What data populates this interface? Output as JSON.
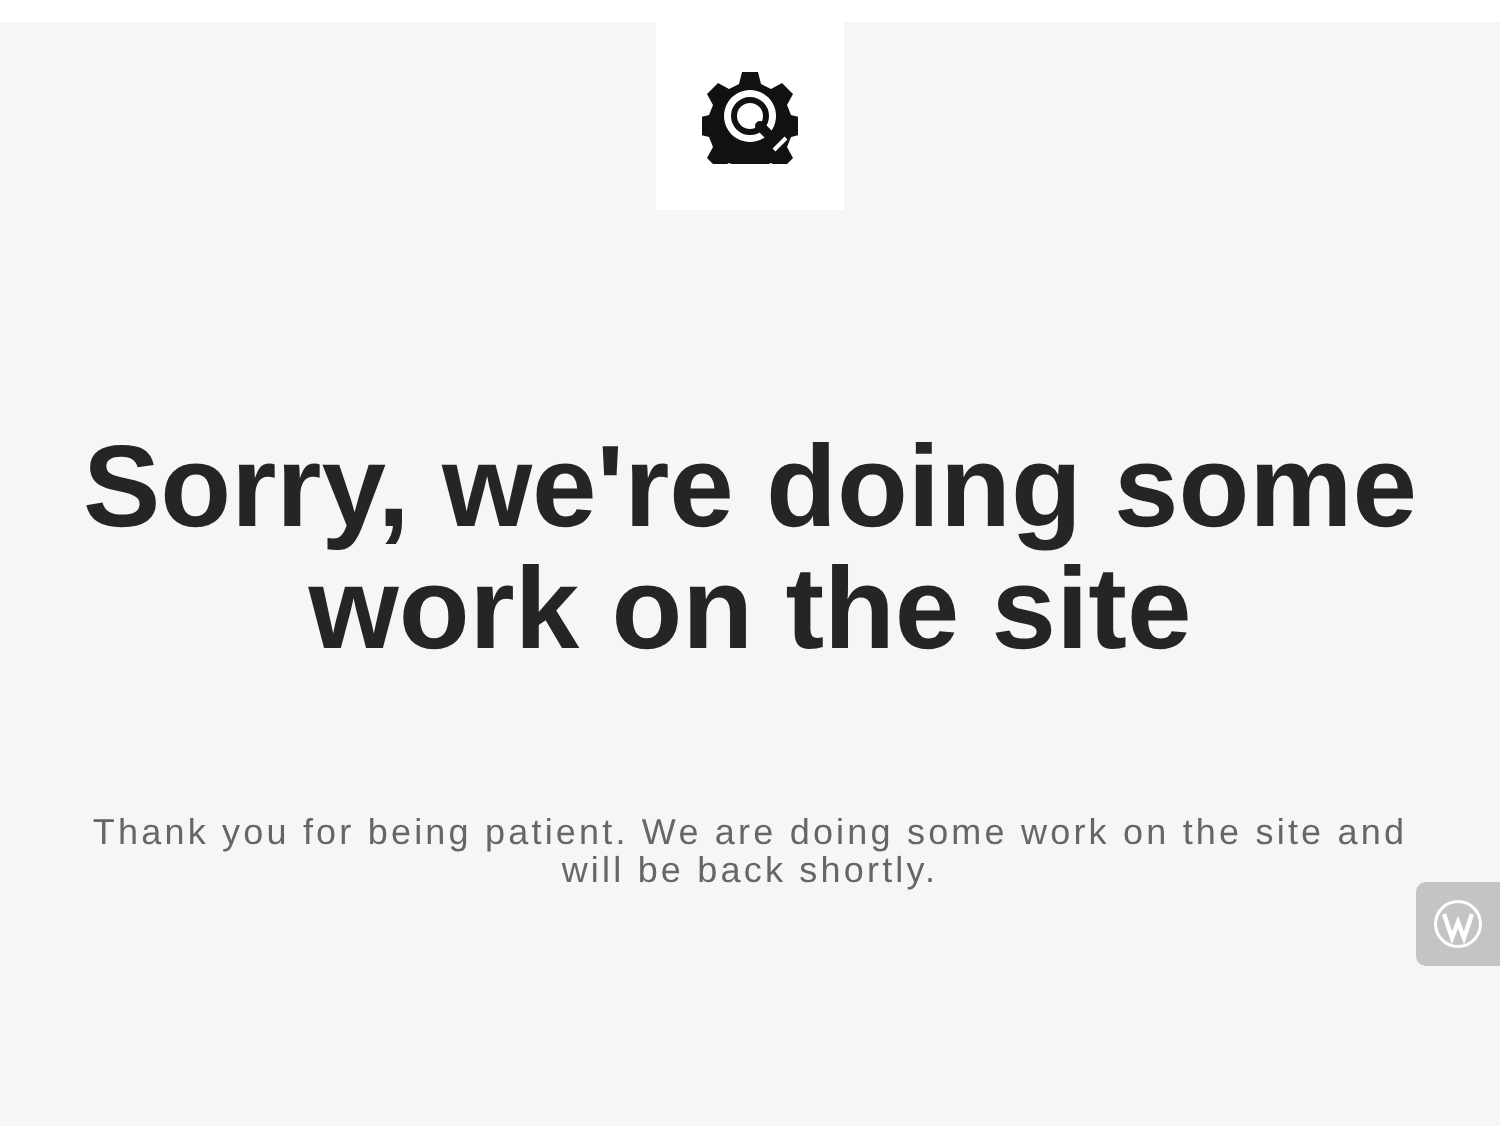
{
  "heading": "Sorry, we're doing some work on the site",
  "message": "Thank you for being patient. We are doing some work on the site and will be back shortly."
}
